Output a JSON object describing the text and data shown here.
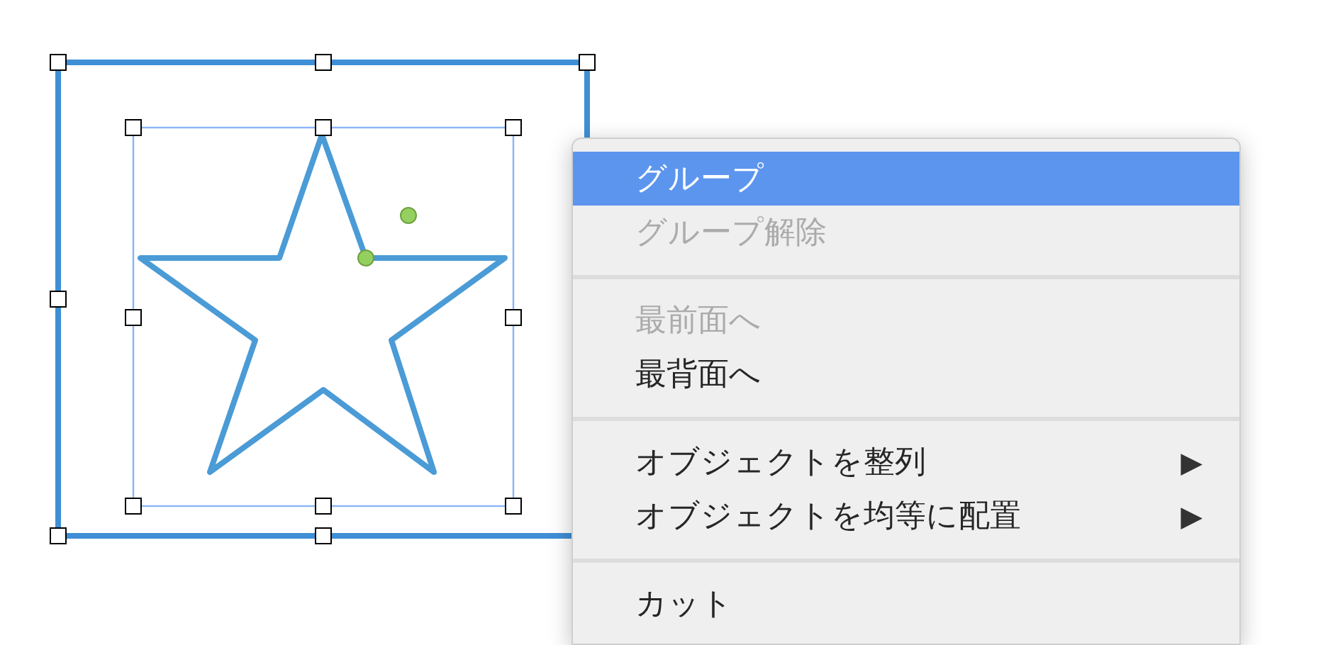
{
  "context_menu": {
    "items": [
      {
        "kind": "item",
        "label": "グループ",
        "selected": true,
        "disabled": false
      },
      {
        "kind": "item",
        "label": "グループ解除",
        "selected": false,
        "disabled": true
      },
      {
        "kind": "separator"
      },
      {
        "kind": "item",
        "label": "最前面へ",
        "selected": false,
        "disabled": true
      },
      {
        "kind": "item",
        "label": "最背面へ",
        "selected": false,
        "disabled": false
      },
      {
        "kind": "separator"
      },
      {
        "kind": "item",
        "label": "オブジェクトを整列",
        "selected": false,
        "disabled": false,
        "arrow": "▶"
      },
      {
        "kind": "item",
        "label": "オブジェクトを均等に配置",
        "selected": false,
        "disabled": false,
        "arrow": "▶"
      },
      {
        "kind": "separator"
      },
      {
        "kind": "item",
        "label": "カット",
        "selected": false,
        "disabled": false
      }
    ]
  }
}
